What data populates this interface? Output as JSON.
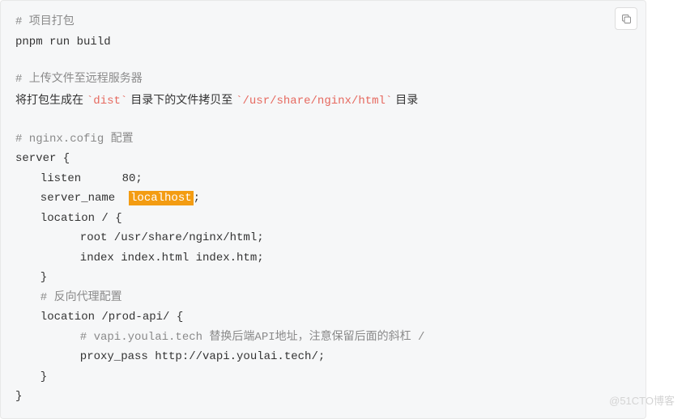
{
  "code": {
    "c1": "# 项目打包",
    "l1": "pnpm run build",
    "c2": "# 上传文件至远程服务器",
    "l2a": "将打包生成在 ",
    "l2b_tick": "`",
    "l2b": "dist",
    "l2c": " 目录下的文件拷贝至 ",
    "l2d": "/usr/share/nginx/html",
    "l2e": " 目录",
    "c3": "# nginx.cofig 配置",
    "l3": "server {",
    "l4": "listen      80;",
    "l5a": "server_name  ",
    "l5b": "localhost",
    "l5c": ";",
    "l6": "location / {",
    "l7": "root /usr/share/nginx/html;",
    "l8": "index index.html index.htm;",
    "l9": "}",
    "c4": "# 反向代理配置",
    "l10": "location /prod-api/ {",
    "c5": "# vapi.youlai.tech 替换后端API地址，注意保留后面的斜杠 /",
    "l11": "proxy_pass http://vapi.youlai.tech/;",
    "l12": "}",
    "l13": "}"
  },
  "watermark": "@51CTO博客"
}
